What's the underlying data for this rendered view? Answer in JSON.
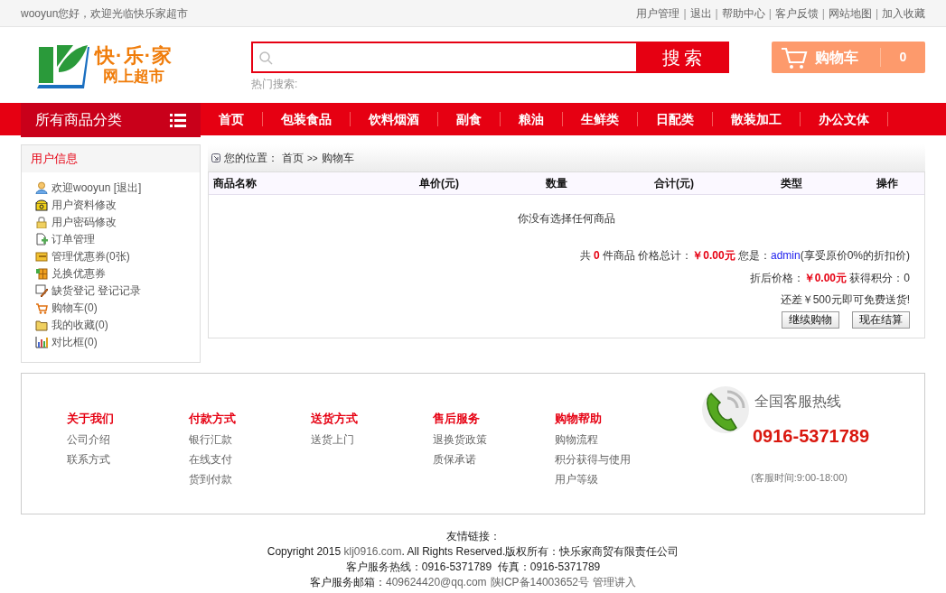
{
  "top_bar": {
    "greeting": "wooyun您好，欢迎光临快乐家超市",
    "separator": "|",
    "links": [
      "用户管理",
      "退出",
      "帮助中心",
      "客户反馈",
      "网站地图",
      "加入收藏"
    ]
  },
  "header": {
    "logo_line_1": "快·乐·家",
    "logo_line_2": "网上超市",
    "search": {
      "button": "搜索"
    },
    "hot_search": "热门搜索:",
    "cart": {
      "label": "购物车",
      "count": "0"
    }
  },
  "nav": {
    "category_label": "所有商品分类",
    "items": [
      {
        "label": "首页"
      },
      {
        "label": "包装食品"
      },
      {
        "label": "饮料烟酒"
      },
      {
        "label": "副食"
      },
      {
        "label": "粮油"
      },
      {
        "label": "生鲜类"
      },
      {
        "label": "日配类"
      },
      {
        "label": "散装加工"
      },
      {
        "label": "办公文体"
      }
    ]
  },
  "sidebar": {
    "title": "用户信息",
    "items": [
      {
        "kind": "user",
        "label": "欢迎wooyun [退出]"
      },
      {
        "kind": "phone",
        "label": "用户资料修改"
      },
      {
        "kind": "lock",
        "label": "用户密码修改"
      },
      {
        "kind": "doc",
        "label": "订单管理"
      },
      {
        "kind": "coupon",
        "label": "管理优惠券(0张)"
      },
      {
        "kind": "grid",
        "label": "兑换优惠券"
      },
      {
        "kind": "pen",
        "label": "缺货登记 登记记录"
      },
      {
        "kind": "cart",
        "label": "购物车(0)"
      },
      {
        "kind": "folder",
        "label": "我的收藏(0)"
      },
      {
        "kind": "chart",
        "label": "对比框(0)"
      }
    ]
  },
  "breadcrumb": {
    "label": "您的位置：",
    "home": "首页",
    "separator": ">>",
    "current": "购物车"
  },
  "cart_table": {
    "columns": [
      "商品名称",
      "单价(元)",
      "数量",
      "合计(元)",
      "类型",
      "操作"
    ],
    "empty_message": "你没有选择任何商品"
  },
  "summary": {
    "count_prefix": "共",
    "count": "0",
    "count_suffix": "件商品 价格总计：",
    "total": "￥0.00元",
    "member_prefix": "您是：",
    "member_level": "admin",
    "member_suffix": "(享受原价0%的折扣价)",
    "discount_label": "折后价格：",
    "discount_price": "￥0.00元",
    "points": "获得积分：0",
    "shipping_note": "还差￥500元即可免费送货!",
    "buttons": [
      "继续购物",
      "现在结算"
    ]
  },
  "footer": {
    "columns": [
      {
        "title": "关于我们",
        "links": [
          "公司介绍",
          "联系方式"
        ]
      },
      {
        "title": "付款方式",
        "links": [
          "银行汇款",
          "在线支付",
          "货到付款"
        ]
      },
      {
        "title": "送货方式",
        "links": [
          "送货上门"
        ]
      },
      {
        "title": "售后服务",
        "links": [
          "退换货政策",
          "质保承诺"
        ]
      },
      {
        "title": "购物帮助",
        "links": [
          "购物流程",
          "积分获得与使用",
          "用户等级"
        ]
      }
    ],
    "hotline_label": "全国客服热线",
    "hotline": "0916-5371789",
    "hours": "(客服时间:9:00-18:00)"
  },
  "bottom": {
    "friend_links": "友情链接：",
    "copyright_prefix": "Copyright 2015",
    "site": "klj0916.com",
    "copyright_suffix": ". All Rights Reserved.版权所有：快乐家商贸有限责任公司",
    "phone_line": "客户服务热线：0916-5371789  传真：0916-5371789",
    "email_label": "客户服务邮箱：",
    "email": "409624420@qq.com",
    "icp": "陕ICP备14003652号",
    "admin_link": "管理讲入"
  }
}
